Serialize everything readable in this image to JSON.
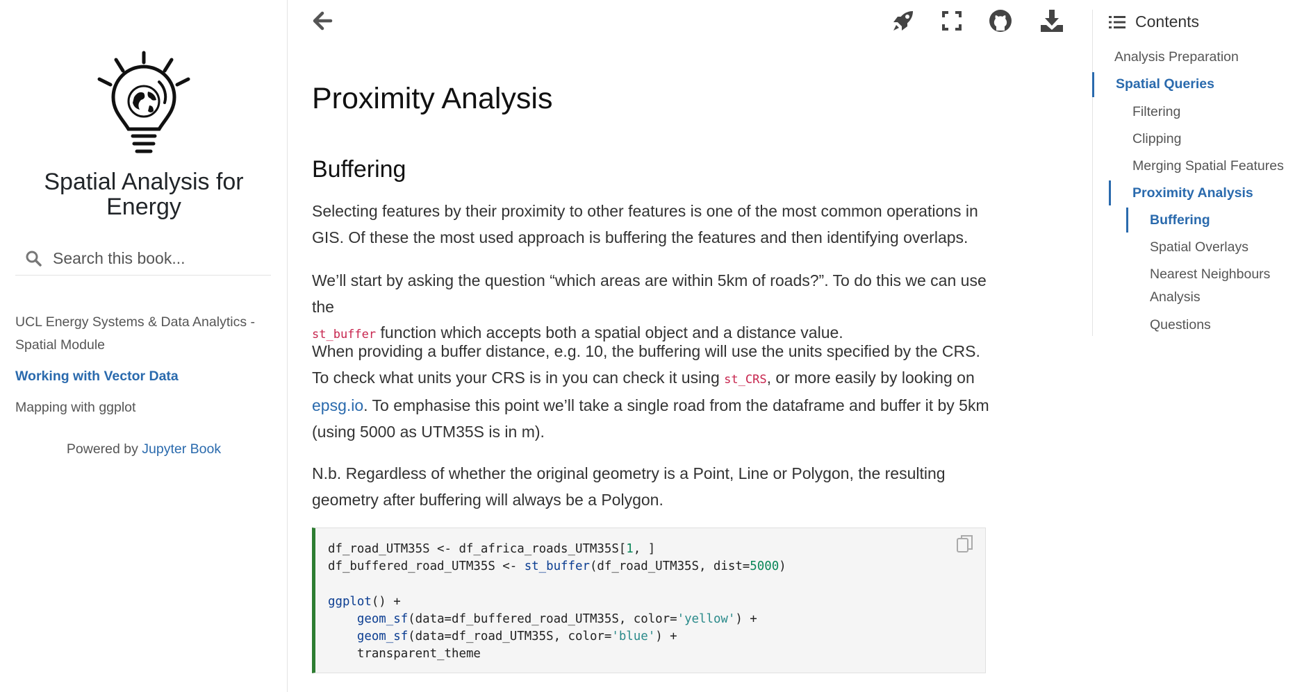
{
  "sidebar": {
    "book_title_line1": "Spatial Analysis for",
    "book_title_line2": "Energy",
    "search_placeholder": "Search this book...",
    "nav": [
      {
        "label": "UCL Energy Systems & Data Analytics -",
        "label2": "Spatial Module",
        "active": false
      },
      {
        "label": "Working with Vector Data",
        "active": true
      },
      {
        "label": "Mapping with ggplot",
        "active": false
      }
    ],
    "powered_prefix": "Powered by",
    "powered_link": "Jupyter Book"
  },
  "topbar": {
    "icons": [
      "back-arrow-icon",
      "rocket-icon",
      "fullscreen-icon",
      "github-icon",
      "download-icon"
    ]
  },
  "main": {
    "page_title": "Proximity Analysis",
    "section_title": "Buffering",
    "p1": "Selecting features by their proximity to other features is one of the most common operations in GIS. Of these the most used approach is buffering the features and then identifying overlaps.",
    "p2_a": "We’ll start by asking the question “which areas are within 5km of roads?”. To do this we can use the",
    "p2_code": "st_buffer",
    "p2_b": " function which accepts both a spatial object and a distance value.",
    "p3_a": "When providing a buffer distance, e.g. 10, the buffering will use the units specified by the CRS. To check what units your CRS is in you can check it using ",
    "p3_code": "st_CRS",
    "p3_b": ", or more easily by looking on ",
    "p3_link": "epsg.io",
    "p3_c": ". To emphasise this point we’ll take a single road from the dataframe and buffer it by 5km (using 5000 as UTM35S is in m).",
    "p4": "N.b. Regardless of whether the original geometry is a Point, Line or Polygon, the resulting geometry after buffering will always be a Polygon.",
    "code": {
      "line1_a": "df_road_UTM35S <- df_africa_roads_UTM35S[",
      "line1_num": "1",
      "line1_b": ", ]",
      "line2_a": "df_buffered_road_UTM35S <- ",
      "line2_fn": "st_buffer",
      "line2_b": "(df_road_UTM35S, dist=",
      "line2_num": "5000",
      "line2_c": ")",
      "line4_fn": "ggplot",
      "line4_b": "() +",
      "line5_fn": "geom_sf",
      "line5_b": "(data=df_buffered_road_UTM35S, color=",
      "line5_str": "'yellow'",
      "line5_c": ") +",
      "line6_fn": "geom_sf",
      "line6_b": "(data=df_road_UTM35S, color=",
      "line6_str": "'blue'",
      "line6_c": ") +",
      "line7": "transparent_theme"
    }
  },
  "toc": {
    "header": "Contents",
    "items": [
      {
        "label": "Analysis Preparation",
        "level": 1,
        "active": false
      },
      {
        "label": "Spatial Queries",
        "level": 1,
        "active": true
      },
      {
        "label": "Filtering",
        "level": 2,
        "active": false
      },
      {
        "label": "Clipping",
        "level": 2,
        "active": false
      },
      {
        "label": "Merging Spatial Features",
        "level": 2,
        "active": false
      },
      {
        "label": "Proximity Analysis",
        "level": 2,
        "active": true
      },
      {
        "label": "Buffering",
        "level": 3,
        "active": true
      },
      {
        "label": "Spatial Overlays",
        "level": 3,
        "active": false
      },
      {
        "label": "Nearest Neighbours",
        "label2": "Analysis",
        "level": 3,
        "active": false
      },
      {
        "label": "Questions",
        "level": 3,
        "active": false
      }
    ]
  },
  "colors": {
    "link": "#2a6aad",
    "inline_code": "#c7254e",
    "code_border": "#2e7d32"
  }
}
